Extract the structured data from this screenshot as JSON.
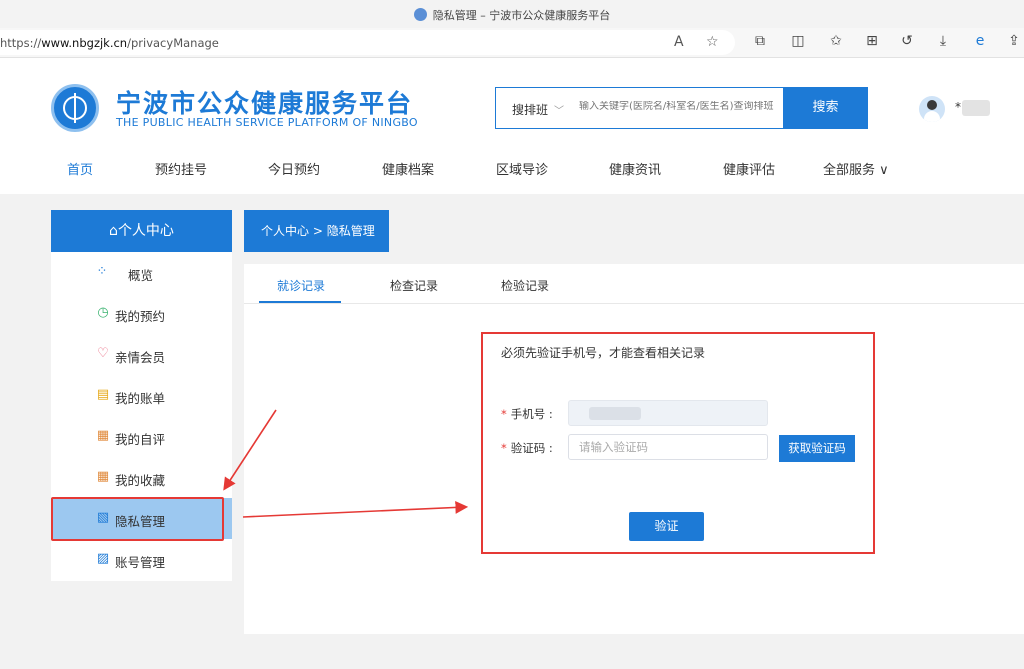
{
  "browser": {
    "title": "隐私管理 – 宁波市公众健康服务平台",
    "url_prefix": "https://",
    "url_domain": "www.nbgzjk.cn",
    "url_path": "/privacyManage"
  },
  "header": {
    "title": "宁波市公众健康服务平台",
    "subtitle": "THE PUBLIC HEALTH SERVICE PLATFORM OF NINGBO",
    "search": {
      "type": "搜排班",
      "placeholder": "输入关键字(医院名/科室名/医生名)查询排班",
      "button": "搜索"
    },
    "user_prefix": "*"
  },
  "nav": {
    "items": [
      "首页",
      "预约挂号",
      "今日预约",
      "健康档案",
      "区域导诊",
      "健康资讯",
      "健康评估",
      "全部服务"
    ]
  },
  "sidebar": {
    "title": "个人中心",
    "items": [
      {
        "label": "概览",
        "icon": "grid-icon"
      },
      {
        "label": "我的预约",
        "icon": "clock-icon"
      },
      {
        "label": "亲情会员",
        "icon": "heart-icon"
      },
      {
        "label": "我的账单",
        "icon": "bill-icon"
      },
      {
        "label": "我的自评",
        "icon": "evaluation-icon"
      },
      {
        "label": "我的收藏",
        "icon": "favorite-icon"
      },
      {
        "label": "隐私管理",
        "icon": "privacy-icon"
      },
      {
        "label": "账号管理",
        "icon": "account-icon"
      }
    ]
  },
  "breadcrumb": {
    "parent": "个人中心",
    "separator": ">",
    "current": "隐私管理"
  },
  "tabs": [
    "就诊记录",
    "检查记录",
    "检验记录"
  ],
  "verify": {
    "notice": "必须先验证手机号，才能查看相关记录",
    "phone_label": "手机号",
    "code_label": "验证码",
    "required_mark": "*",
    "code_placeholder": "请输入验证码",
    "get_code_button": "获取验证码",
    "submit_button": "验证"
  },
  "colors": {
    "primary": "#1d7ad6",
    "annotation": "#e53935",
    "sidebar_active": "#9cc8f0"
  }
}
